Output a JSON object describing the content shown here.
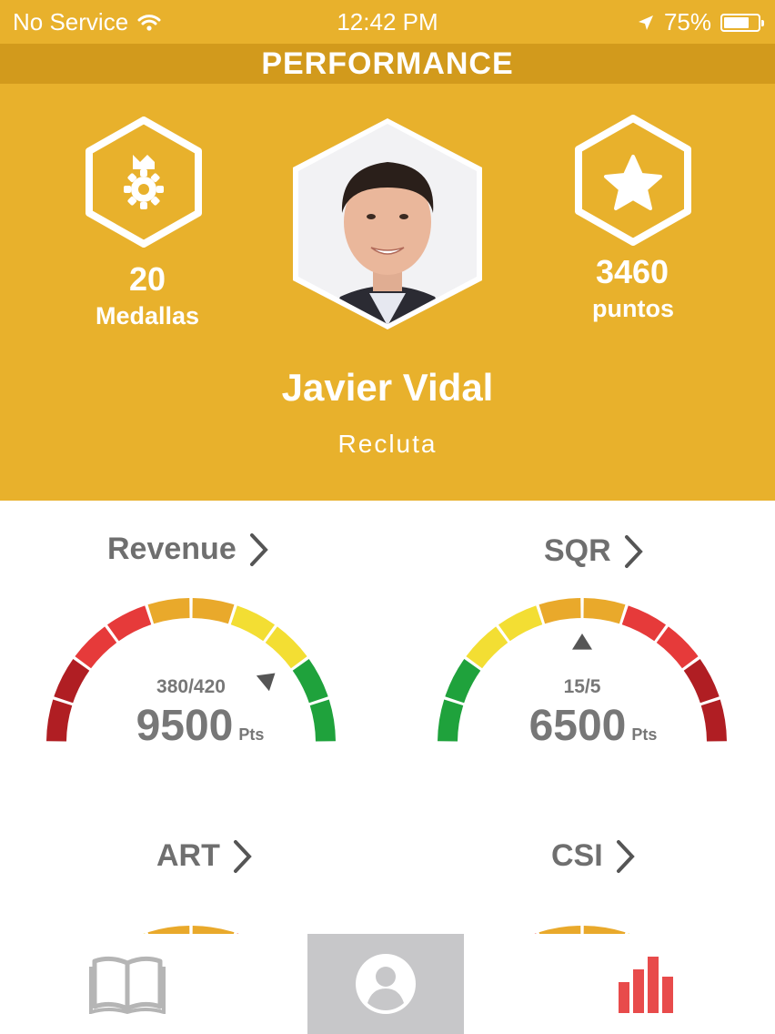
{
  "status_bar": {
    "carrier": "No Service",
    "time": "12:42 PM",
    "battery": "75%",
    "battery_level": 0.75
  },
  "header": {
    "title": "PERFORMANCE"
  },
  "profile": {
    "medals": {
      "value": "20",
      "label": "Medallas",
      "icon": "medal-icon"
    },
    "points": {
      "value": "3460",
      "label": "puntos",
      "icon": "star-icon"
    },
    "name": "Javier Vidal",
    "role": "Recluta",
    "avatar": "user-photo"
  },
  "gauges": [
    {
      "title": "Revenue",
      "ratio": "380/420",
      "points": "9500",
      "unit": "Pts",
      "pointer_fraction": 0.78,
      "direction": "red-to-green"
    },
    {
      "title": "SQR",
      "ratio": "15/5",
      "points": "6500",
      "unit": "Pts",
      "pointer_fraction": 0.5,
      "direction": "green-to-red"
    },
    {
      "title": "ART"
    },
    {
      "title": "CSI"
    }
  ],
  "tab_bar": {
    "items": [
      {
        "icon": "book-icon",
        "active": false
      },
      {
        "icon": "profile-icon",
        "active": true
      },
      {
        "icon": "bar-chart-icon",
        "active": false
      }
    ]
  },
  "colors": {
    "brand": "#e8b12c",
    "brand_dark": "#d29a1c",
    "dark_red": "#b01e23",
    "red": "#e63a3a",
    "orange": "#e9a92b",
    "yellow": "#f3de33",
    "green": "#1fa23c",
    "chart_accent": "#e84b4b"
  }
}
